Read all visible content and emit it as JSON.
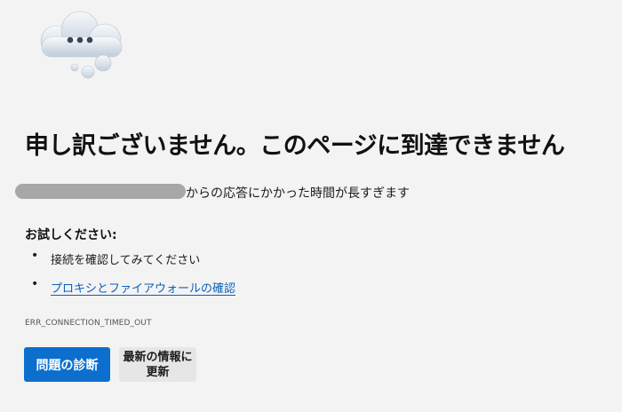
{
  "icons": {
    "hero": "cloud-ellipsis-icon",
    "bullet": "bullet-icon"
  },
  "colors": {
    "background": "#f3f3f3",
    "primary_button": "#0c6fce",
    "link": "#0a60b8",
    "secondary_button": "#e6e6e6"
  },
  "error": {
    "title": "申し訳ございません。このページに到達できません",
    "detail": "からの応答にかかった時間が長すぎます",
    "code": "ERR_CONNECTION_TIMED_OUT"
  },
  "suggestions": {
    "heading": "お試しください:",
    "items": [
      {
        "bullet": "•",
        "text": "接続を確認してみてください"
      },
      {
        "bullet": "•",
        "text": "プロキシとファイアウォールの確認"
      }
    ]
  },
  "buttons": {
    "diagnose": "問題の診断",
    "refresh": "最新の情報に更新"
  }
}
